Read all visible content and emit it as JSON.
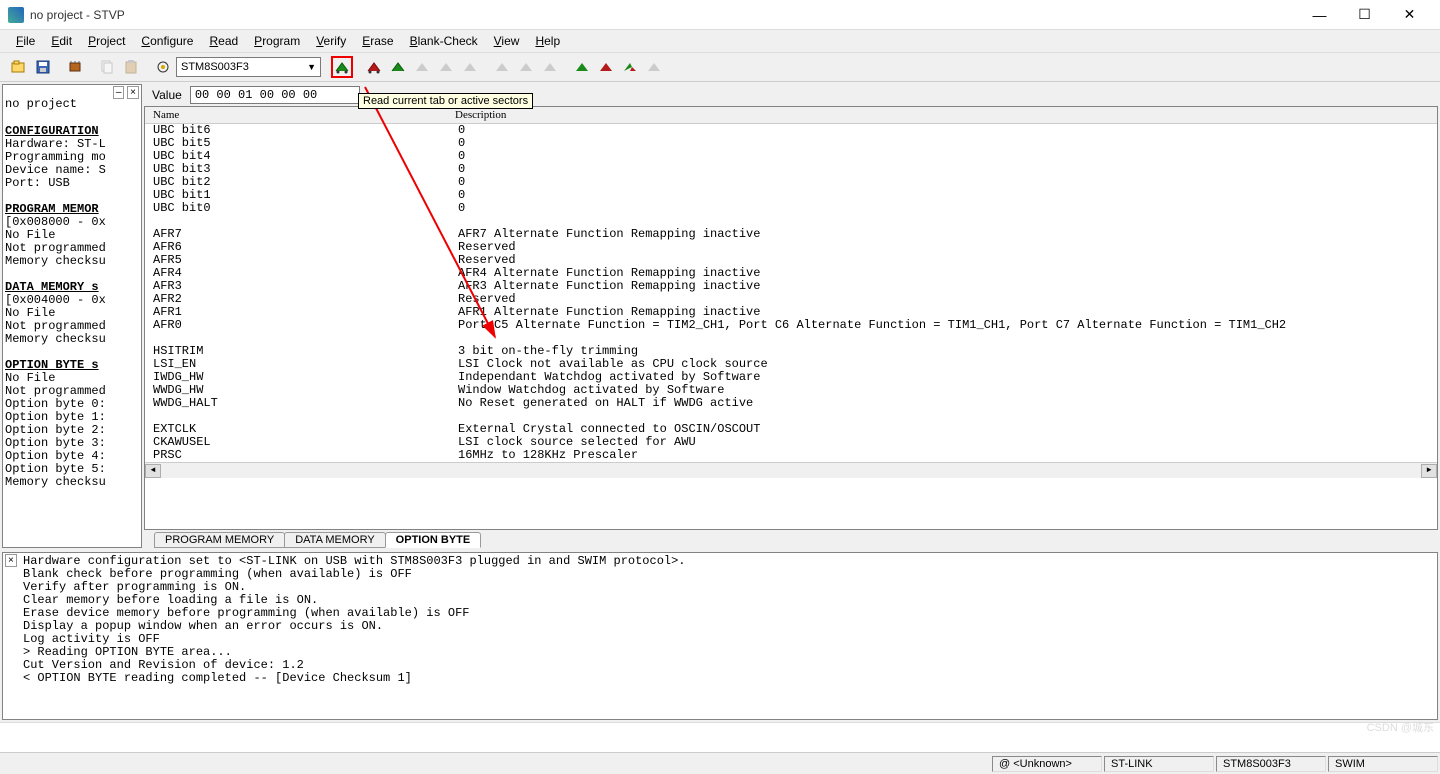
{
  "window": {
    "title": "no project - STVP"
  },
  "menu": [
    "File",
    "Edit",
    "Project",
    "Configure",
    "Read",
    "Program",
    "Verify",
    "Erase",
    "Blank-Check",
    "View",
    "Help"
  ],
  "device": "STM8S003F3",
  "tooltip": "Read current tab or active sectors",
  "value_label": "Value",
  "value_hex": "00 00 01 00 00 00",
  "table_headers": {
    "name": "Name",
    "desc": "Description"
  },
  "rows": [
    {
      "n": "UBC bit6",
      "d": "0"
    },
    {
      "n": "UBC bit5",
      "d": "0"
    },
    {
      "n": "UBC bit4",
      "d": "0"
    },
    {
      "n": "UBC bit3",
      "d": "0"
    },
    {
      "n": "UBC bit2",
      "d": "0"
    },
    {
      "n": "UBC bit1",
      "d": "0"
    },
    {
      "n": "UBC bit0",
      "d": "0"
    },
    {
      "blank": true
    },
    {
      "n": "AFR7",
      "d": "AFR7 Alternate Function Remapping inactive"
    },
    {
      "n": "AFR6",
      "d": "Reserved"
    },
    {
      "n": "AFR5",
      "d": "Reserved"
    },
    {
      "n": "AFR4",
      "d": "AFR4 Alternate Function Remapping inactive"
    },
    {
      "n": "AFR3",
      "d": "AFR3 Alternate Function Remapping inactive"
    },
    {
      "n": "AFR2",
      "d": "Reserved"
    },
    {
      "n": "AFR1",
      "d": "AFR1 Alternate Function Remapping inactive"
    },
    {
      "n": "AFR0",
      "d": "Port C5 Alternate Function = TIM2_CH1, Port C6 Alternate Function = TIM1_CH1, Port C7 Alternate Function = TIM1_CH2"
    },
    {
      "blank": true
    },
    {
      "n": "HSITRIM",
      "d": "3 bit on-the-fly trimming"
    },
    {
      "n": "LSI_EN",
      "d": "LSI Clock not available as CPU clock source"
    },
    {
      "n": "IWDG_HW",
      "d": "Independant Watchdog activated by Software"
    },
    {
      "n": "WWDG_HW",
      "d": "Window Watchdog activated by Software"
    },
    {
      "n": "WWDG_HALT",
      "d": "No Reset generated on HALT if WWDG active"
    },
    {
      "blank": true
    },
    {
      "n": "EXTCLK",
      "d": "External Crystal connected to OSCIN/OSCOUT"
    },
    {
      "n": "CKAWUSEL",
      "d": "LSI clock source selected for AWU"
    },
    {
      "n": "PRSC",
      "d": "16MHz to 128KHz Prescaler"
    }
  ],
  "tabs": [
    "PROGRAM MEMORY",
    "DATA MEMORY",
    "OPTION BYTE"
  ],
  "active_tab": 2,
  "left": {
    "project": "no project",
    "sections": [
      {
        "hdr": "CONFIGURATION",
        "lines": [
          "Hardware: ST-L",
          "Programming mo",
          "Device name: S",
          "Port: USB"
        ]
      },
      {
        "hdr": "PROGRAM MEMOR",
        "lines": [
          "[0x008000 - 0x",
          "No File",
          "Not programmed",
          "Memory checksu"
        ]
      },
      {
        "hdr": "DATA MEMORY s",
        "lines": [
          "[0x004000 - 0x",
          "No File",
          "Not programmed",
          "Memory checksu"
        ]
      },
      {
        "hdr": "OPTION BYTE s",
        "lines": [
          "No File",
          "Not programmed",
          "Option byte 0:",
          "Option byte 1:",
          "Option byte 2:",
          "Option byte 3:",
          "Option byte 4:",
          "Option byte 5:",
          "Memory checksu"
        ]
      }
    ]
  },
  "log": [
    "Hardware configuration set to <ST-LINK on USB with STM8S003F3 plugged in and SWIM protocol>.",
    "Blank check before programming (when available) is OFF",
    "Verify after programming is ON.",
    "Clear memory before loading a file is ON.",
    "Erase device memory before programming (when available) is OFF",
    "Display a popup window when an error occurs is ON.",
    "Log activity is OFF",
    "> Reading  OPTION BYTE area...",
    "Cut Version and Revision of device: 1.2",
    "< OPTION BYTE reading completed -- [Device Checksum 1]"
  ],
  "status": {
    "addr": "@ <Unknown>",
    "link": "ST-LINK",
    "dev": "STM8S003F3",
    "proto": "SWIM"
  },
  "watermark": "CSDN @城东"
}
